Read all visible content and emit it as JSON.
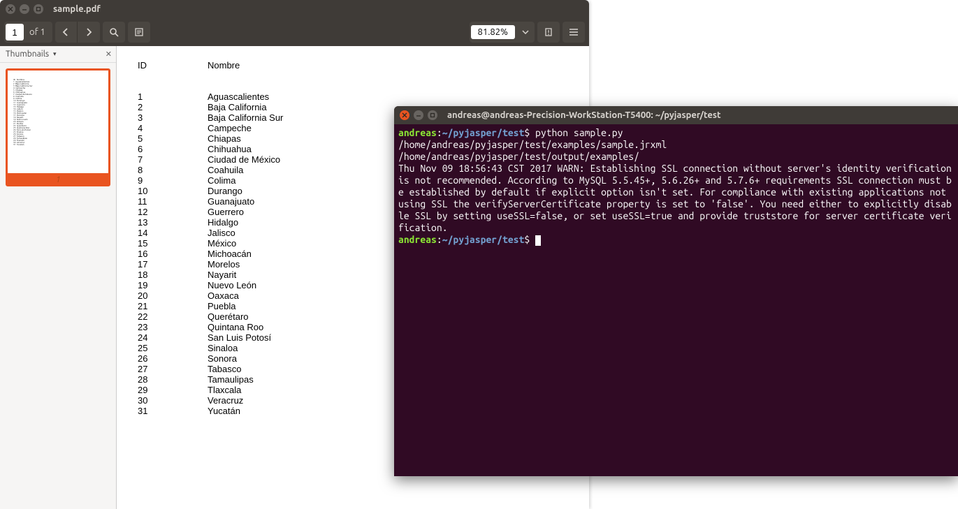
{
  "pdf": {
    "title": "sample.pdf",
    "page_current": "1",
    "page_of_label": "of 1",
    "zoom": "81.82%",
    "thumb_panel_label": "Thumbnails",
    "thumb_page_label": "1",
    "columns": {
      "id": "ID",
      "nombre": "Nombre"
    },
    "rows": [
      {
        "id": "1",
        "nombre": "Aguascalientes"
      },
      {
        "id": "2",
        "nombre": "Baja California"
      },
      {
        "id": "3",
        "nombre": "Baja California Sur"
      },
      {
        "id": "4",
        "nombre": "Campeche"
      },
      {
        "id": "5",
        "nombre": "Chiapas"
      },
      {
        "id": "6",
        "nombre": "Chihuahua"
      },
      {
        "id": "7",
        "nombre": "Ciudad de México"
      },
      {
        "id": "8",
        "nombre": "Coahuila"
      },
      {
        "id": "9",
        "nombre": "Colima"
      },
      {
        "id": "10",
        "nombre": "Durango"
      },
      {
        "id": "11",
        "nombre": "Guanajuato"
      },
      {
        "id": "12",
        "nombre": "Guerrero"
      },
      {
        "id": "13",
        "nombre": "Hidalgo"
      },
      {
        "id": "14",
        "nombre": "Jalisco"
      },
      {
        "id": "15",
        "nombre": "México"
      },
      {
        "id": "16",
        "nombre": "Michoacán"
      },
      {
        "id": "17",
        "nombre": "Morelos"
      },
      {
        "id": "18",
        "nombre": "Nayarit"
      },
      {
        "id": "19",
        "nombre": "Nuevo León"
      },
      {
        "id": "20",
        "nombre": "Oaxaca"
      },
      {
        "id": "21",
        "nombre": "Puebla"
      },
      {
        "id": "22",
        "nombre": "Querétaro"
      },
      {
        "id": "23",
        "nombre": "Quintana Roo"
      },
      {
        "id": "24",
        "nombre": "San Luis Potosí"
      },
      {
        "id": "25",
        "nombre": "Sinaloa"
      },
      {
        "id": "26",
        "nombre": "Sonora"
      },
      {
        "id": "27",
        "nombre": "Tabasco"
      },
      {
        "id": "28",
        "nombre": "Tamaulipas"
      },
      {
        "id": "29",
        "nombre": "Tlaxcala"
      },
      {
        "id": "30",
        "nombre": "Veracruz"
      },
      {
        "id": "31",
        "nombre": "Yucatán"
      }
    ]
  },
  "terminal": {
    "title": "andreas@andreas-Precision-WorkStation-T5400: ~/pyjasper/test",
    "prompt_user": "andreas",
    "prompt_path": "~/pyjasper/test",
    "command": "python sample.py",
    "lines": [
      "/home/andreas/pyjasper/test/examples/sample.jrxml",
      "/home/andreas/pyjasper/test/output/examples/",
      "Thu Nov 09 18:56:43 CST 2017 WARN: Establishing SSL connection without server's identity verification is not recommended. According to MySQL 5.5.45+, 5.6.26+ and 5.7.6+ requirements SSL connection must be established by default if explicit option isn't set. For compliance with existing applications not using SSL the verifyServerCertificate property is set to 'false'. You need either to explicitly disable SSL by setting useSSL=false, or set useSSL=true and provide truststore for server certificate verification."
    ]
  }
}
